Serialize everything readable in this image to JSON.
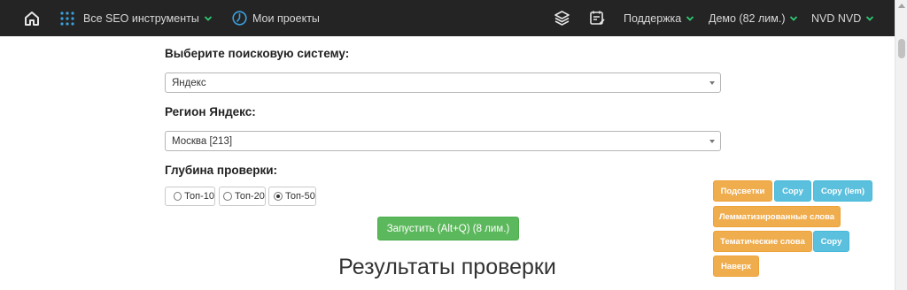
{
  "nav": {
    "all_tools": "Все SEO инструменты",
    "projects": "Мои проекты",
    "support": "Поддержка",
    "demo": "Демо (82 лим.)",
    "user": "NVD NVD"
  },
  "colors": {
    "topbar": "#242424",
    "accent_green": "#2ecc71",
    "accent_blue": "#3aa0e0",
    "run_button": "#5cb85c",
    "orange_button": "#f0ad4e",
    "blue_button": "#5bc0de"
  },
  "form": {
    "engine_label": "Выберите поисковую систему:",
    "engine_value": "Яндекс",
    "region_label": "Регион Яндекс:",
    "region_value": "Москва [213]",
    "depth_label": "Глубина проверки:",
    "depth_options": [
      "Топ-10",
      "Топ-20",
      "Топ-50"
    ],
    "depth_selected": "Топ-50",
    "run_button": "Запустить (Alt+Q) (8 лим.)"
  },
  "results_title": "Результаты проверки",
  "tools": {
    "highlight": "Подсветки",
    "copy1": "Copy",
    "copy_lem": "Copy (lem)",
    "lemmatized": "Лемматизированные слова",
    "thematic": "Тематические слова",
    "copy2": "Copy",
    "top": "Наверх"
  }
}
